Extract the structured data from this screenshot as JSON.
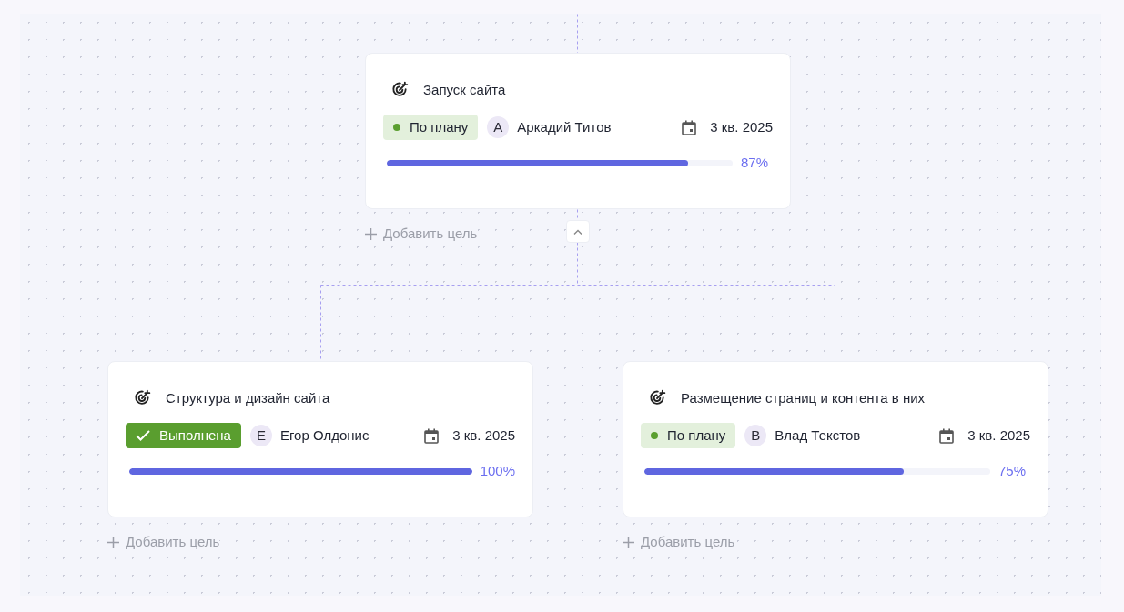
{
  "goal": {
    "title": "Запуск сайта",
    "status": {
      "kind": "on_track",
      "label": "По плану"
    },
    "owner": {
      "initial": "А",
      "name": "Аркадий Титов"
    },
    "period": "3 кв. 2025",
    "level": 0.87,
    "percent": "87%",
    "add_label": "Добавить цель",
    "expanded": true,
    "children": [
      {
        "title": "Структура и дизайн сайта",
        "status": {
          "kind": "done",
          "label": "Выполнена"
        },
        "owner": {
          "initial": "Е",
          "name": "Егор Олдонис"
        },
        "period": "3 кв. 2025",
        "level": 1,
        "percent": "100%",
        "add_label": "Добавить цель"
      },
      {
        "title": "Размещение страниц и контента в них",
        "status": {
          "kind": "on_track",
          "label": "По плану"
        },
        "owner": {
          "initial": "В",
          "name": "Влад Текстов"
        },
        "period": "3 кв. 2025",
        "level": 0.75,
        "percent": "75%",
        "add_label": "Добавить цель"
      }
    ]
  }
}
